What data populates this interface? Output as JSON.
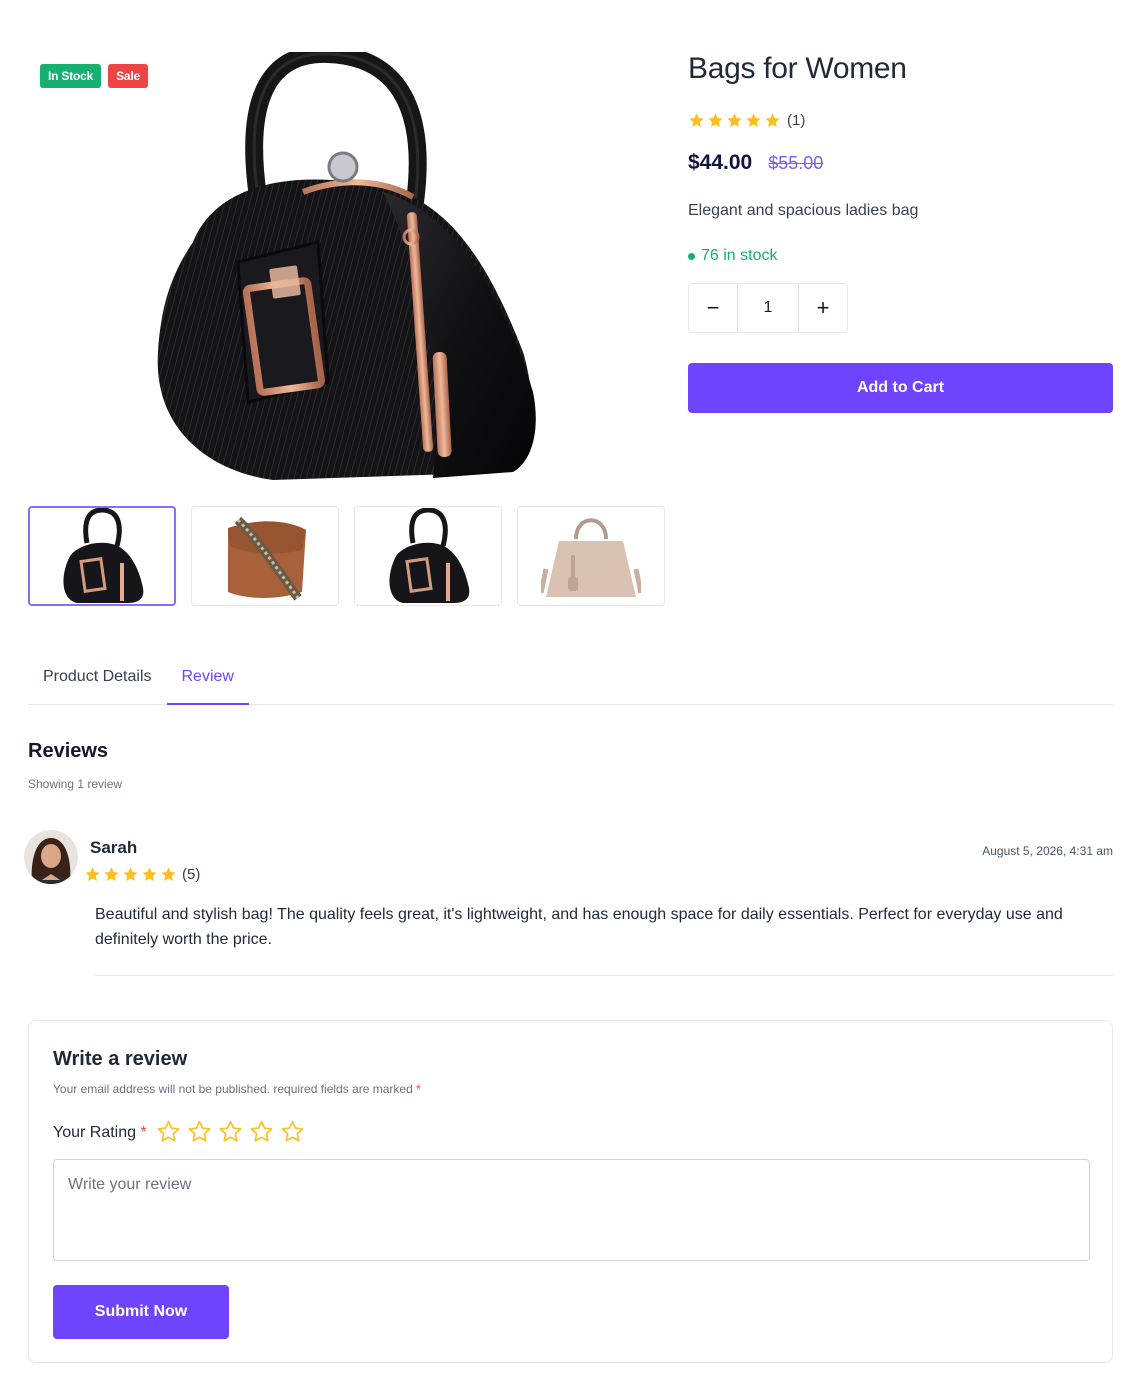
{
  "badges": {
    "in_stock": "In Stock",
    "sale": "Sale"
  },
  "product": {
    "title": "Bags for Women",
    "rating": 5,
    "rating_count": "(1)",
    "price": "$44.00",
    "old_price": "$55.00",
    "description": "Elegant and spacious ladies bag",
    "stock_text": "76 in stock",
    "quantity": "1",
    "minus": "−",
    "plus": "+",
    "add_to_cart": "Add to Cart"
  },
  "gallery": {
    "thumbnails": [
      "black-handbag",
      "brown-crossbody-bag",
      "black-handbag",
      "beige-tote-bag"
    ],
    "active_index": 0
  },
  "tabs": [
    {
      "label": "Product Details",
      "active": false
    },
    {
      "label": "Review",
      "active": true
    }
  ],
  "reviews": {
    "title": "Reviews",
    "subtitle": "Showing 1 review",
    "items": [
      {
        "name": "Sarah",
        "rating": 5,
        "rating_text": "(5)",
        "date": "August 5, 2026, 4:31 am",
        "text": "Beautiful and stylish bag! The quality feels great, it's lightweight, and has enough space for daily essentials. Perfect for everyday use and definitely worth the price."
      }
    ]
  },
  "write_review": {
    "title": "Write a review",
    "note": "Your email address will not be published. required fields are marked",
    "required_mark": "*",
    "rating_label": "Your Rating",
    "placeholder": "Write your review",
    "submit": "Submit Now"
  },
  "colors": {
    "accent": "#6e44ff",
    "stock_green": "#16b070",
    "sale_red": "#ef4444",
    "star_gold": "#fbbf24"
  }
}
